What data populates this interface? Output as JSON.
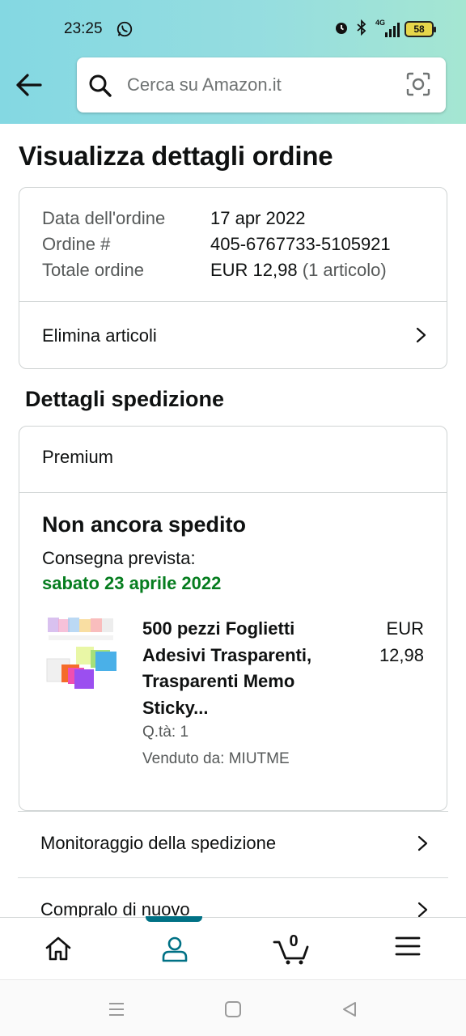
{
  "status_bar": {
    "time": "23:25",
    "network": "4G",
    "battery": "58"
  },
  "search": {
    "placeholder": "Cerca su Amazon.it"
  },
  "page": {
    "title": "Visualizza dettagli ordine"
  },
  "order_summary": {
    "rows": [
      {
        "label": "Data dell'ordine",
        "value": "17 apr 2022"
      },
      {
        "label": "Ordine #",
        "value": "405-6767733-5105921"
      },
      {
        "label": "Totale ordine",
        "value": "EUR 12,98",
        "extra": "(1 articolo)"
      }
    ],
    "delete_items_label": "Elimina articoli"
  },
  "shipping": {
    "section_title": "Dettagli spedizione",
    "service": "Premium",
    "status": "Non ancora spedito",
    "delivery_label": "Consegna prevista:",
    "delivery_date": "sabato 23 aprile 2022",
    "delivery_date_color": "#067d1f",
    "product": {
      "title_lines": [
        "500 pezzi Foglietti",
        "Adesivi Trasparenti,",
        "Trasparenti Memo",
        "Sticky..."
      ],
      "price_lines": [
        "EUR",
        "12,98"
      ],
      "quantity": "Q.tà: 1",
      "seller": "Venduto da: MIUTME"
    }
  },
  "actions": {
    "track_label": "Monitoraggio della spedizione",
    "buy_again_label": "Compralo di nuovo"
  },
  "bottom_nav": {
    "items": [
      "home-icon",
      "account-icon",
      "cart-icon",
      "menu-icon"
    ],
    "active": "account-icon",
    "cart_count": "0",
    "accent_color": "#007185"
  }
}
